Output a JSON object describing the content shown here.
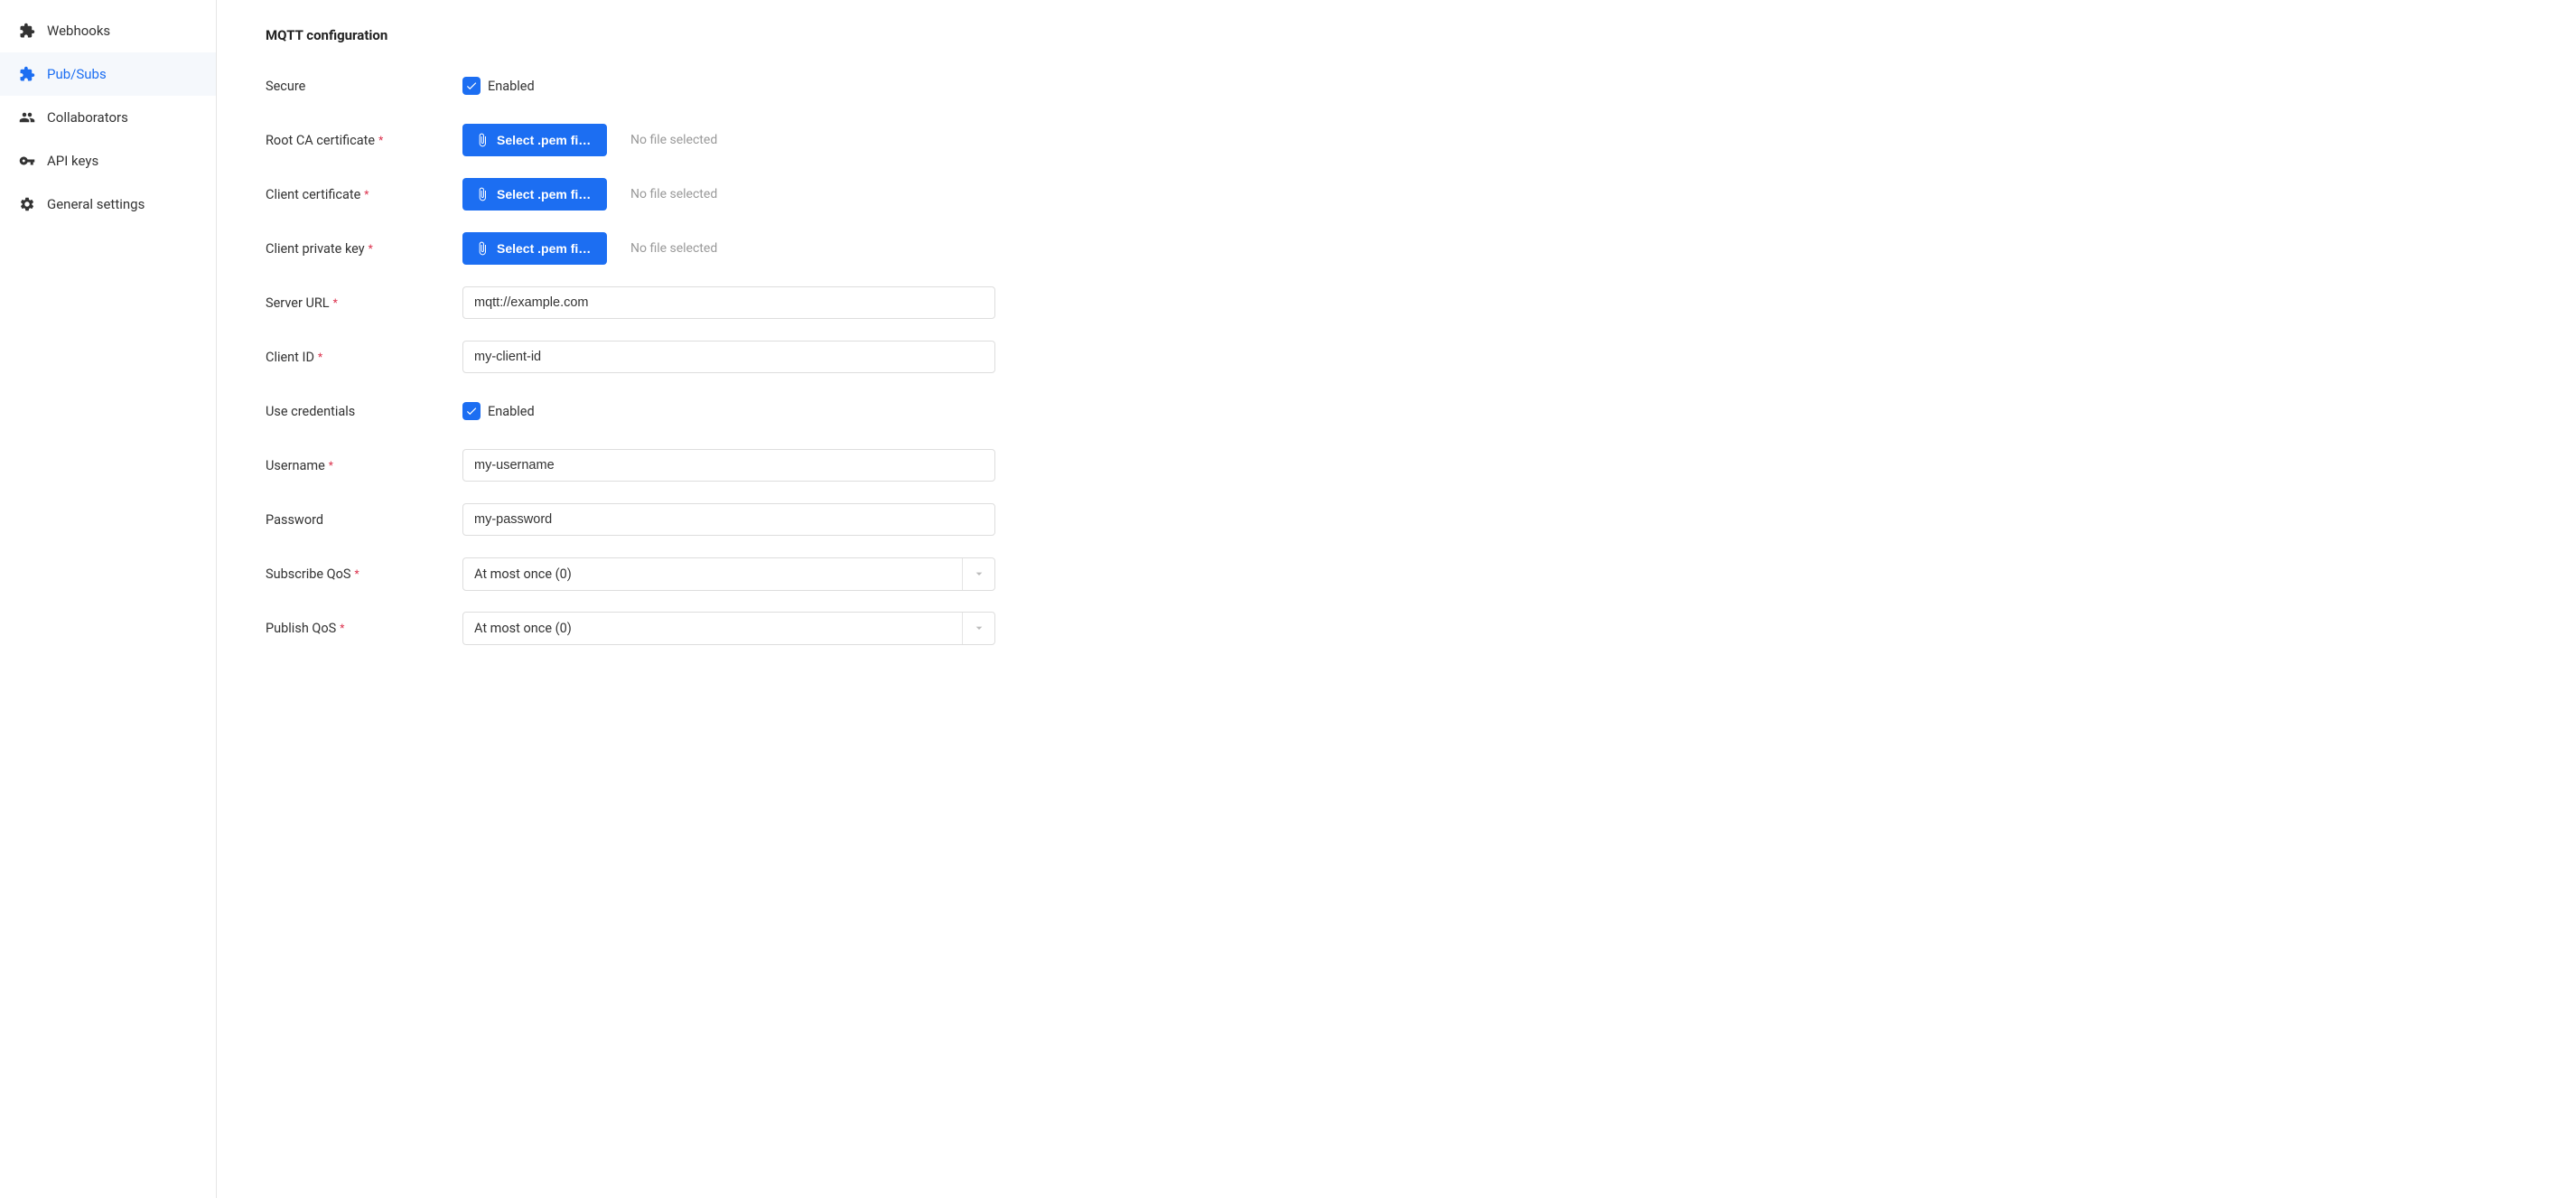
{
  "sidebar": {
    "items": [
      {
        "label": "Webhooks"
      },
      {
        "label": "Pub/Subs"
      },
      {
        "label": "Collaborators"
      },
      {
        "label": "API keys"
      },
      {
        "label": "General settings"
      }
    ]
  },
  "section_title": "MQTT configuration",
  "form": {
    "secure": {
      "label": "Secure",
      "enabled_text": "Enabled"
    },
    "root_ca": {
      "label": "Root CA certificate",
      "button": "Select .pem file…",
      "status": "No file selected"
    },
    "client_cert": {
      "label": "Client certificate",
      "button": "Select .pem file…",
      "status": "No file selected"
    },
    "client_key": {
      "label": "Client private key",
      "button": "Select .pem file…",
      "status": "No file selected"
    },
    "server_url": {
      "label": "Server URL",
      "value": "mqtt://example.com"
    },
    "client_id": {
      "label": "Client ID",
      "value": "my-client-id"
    },
    "use_credentials": {
      "label": "Use credentials",
      "enabled_text": "Enabled"
    },
    "username": {
      "label": "Username",
      "value": "my-username"
    },
    "password": {
      "label": "Password",
      "value": "my-password"
    },
    "subscribe_qos": {
      "label": "Subscribe QoS",
      "value": "At most once (0)"
    },
    "publish_qos": {
      "label": "Publish QoS",
      "value": "At most once (0)"
    }
  }
}
